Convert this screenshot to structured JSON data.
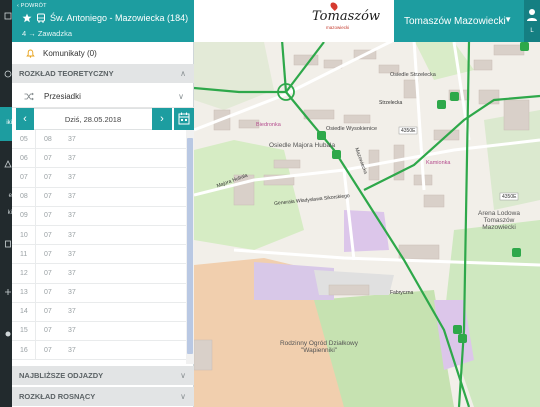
{
  "header": {
    "back_label": "POWRÓT",
    "stop_name": "Św. Antoniego - Mazowiecka (184)",
    "direction": "4 → Zawadzka",
    "accent_color": "#1d9da0",
    "icons": [
      "chevron-left-icon",
      "star-icon",
      "bus-icon"
    ]
  },
  "rail": {
    "items": [
      "iki",
      "e",
      "ki"
    ]
  },
  "panel": {
    "komunikaty": "Komunikaty (0)",
    "rozklad_teoretyczny": "ROZKŁAD TEORETYCZNY",
    "przesiadki": "Przesiadki",
    "date_label": "Dziś, 28.05.2018",
    "najblizsze": "NAJBLIŻSZE ODJAZDY",
    "rozklad_rosnacy": "ROZKŁAD ROSNĄCY"
  },
  "timetable": [
    {
      "hour": "05",
      "min1": "08",
      "min2": "37"
    },
    {
      "hour": "06",
      "min1": "07",
      "min2": "37"
    },
    {
      "hour": "07",
      "min1": "07",
      "min2": "37"
    },
    {
      "hour": "08",
      "min1": "07",
      "min2": "37"
    },
    {
      "hour": "09",
      "min1": "07",
      "min2": "37"
    },
    {
      "hour": "10",
      "min1": "07",
      "min2": "37"
    },
    {
      "hour": "11",
      "min1": "07",
      "min2": "37"
    },
    {
      "hour": "12",
      "min1": "07",
      "min2": "37"
    },
    {
      "hour": "13",
      "min1": "07",
      "min2": "37"
    },
    {
      "hour": "14",
      "min1": "07",
      "min2": "37"
    },
    {
      "hour": "15",
      "min1": "07",
      "min2": "37"
    },
    {
      "hour": "16",
      "min1": "07",
      "min2": "37"
    }
  ],
  "map": {
    "logo": "Tomaszów",
    "logo_sub": "mazowiecki",
    "city": "Tomaszów Mazowiecki",
    "corner": "L",
    "labels": {
      "osiedle_strzelecka": "Osiedle Strzelecka",
      "osiedle_wysokienice": "Osiedle Wysokienice",
      "osiedle_majora": "Osiedle Majora Hubala",
      "generala": "Generała Władysława Sikorskiego",
      "strzelecka": "Strzelecka",
      "mazowiecka": "Mazowiecka",
      "arena": "Arena Lodowa Tomaszów Mazowiecki",
      "ogrod": "Rodzinny Ogród Działkowy \"Wapienniki\"",
      "r4350e": "4350E",
      "r4350e_b": "4350E",
      "biedronka": "Biedronka",
      "kamionka": "Kamionka",
      "hubala": "Majora Hubala",
      "fabryczna": "Fabryczna"
    }
  }
}
